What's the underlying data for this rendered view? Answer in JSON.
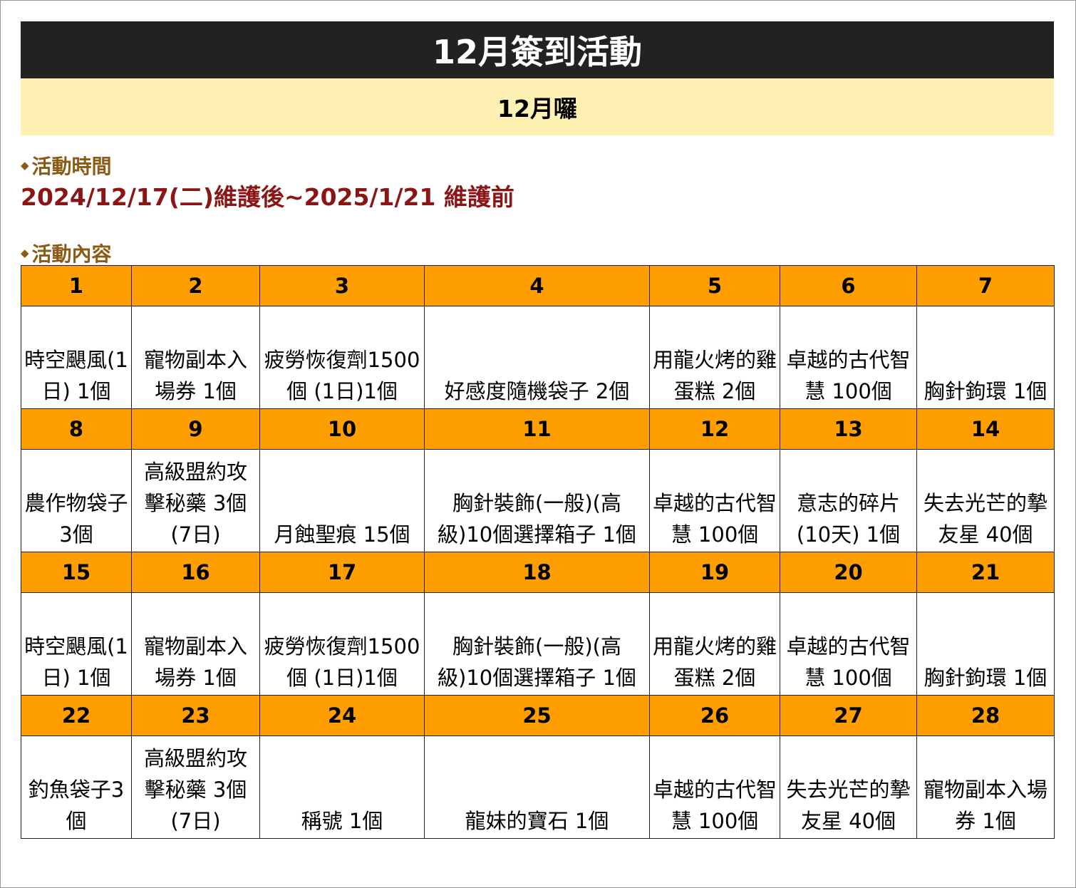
{
  "title": "12月簽到活動",
  "subtitle": "12月囉",
  "colors": {
    "title_bg": "#222222",
    "subtitle_bg": "#fff0b3",
    "header_row": "#ff9e00",
    "section_heading": "#8b5a14",
    "period_text": "#8b1414"
  },
  "sections": {
    "time_heading": "活動時間",
    "period": "2024/12/17(二)維護後~2025/1/21 維護前",
    "content_heading": "活動內容",
    "bullet_icon": "diamond-bullet"
  },
  "weeks": [
    {
      "days": [
        "1",
        "2",
        "3",
        "4",
        "5",
        "6",
        "7"
      ],
      "items": [
        "時空颶風(1日) 1個",
        "寵物副本入場券 1個",
        "疲勞恢復劑1500個 (1日)1個",
        "好感度隨機袋子 2個",
        "用龍火烤的雞蛋糕 2個",
        "卓越的古代智慧 100個",
        "胸針鉤環 1個"
      ]
    },
    {
      "days": [
        "8",
        "9",
        "10",
        "11",
        "12",
        "13",
        "14"
      ],
      "items": [
        "農作物袋子 3個",
        "高級盟約攻擊秘藥 3個(7日)",
        "月蝕聖痕 15個",
        "胸針裝飾(一般)(高級)10個選擇箱子 1個",
        "卓越的古代智慧 100個",
        "意志的碎片(10天) 1個",
        "失去光芒的摯友星 40個"
      ]
    },
    {
      "days": [
        "15",
        "16",
        "17",
        "18",
        "19",
        "20",
        "21"
      ],
      "items": [
        "時空颶風(1日) 1個",
        "寵物副本入場券 1個",
        "疲勞恢復劑1500個 (1日)1個",
        "胸針裝飾(一般)(高級)10個選擇箱子 1個",
        "用龍火烤的雞蛋糕 2個",
        "卓越的古代智慧 100個",
        "胸針鉤環 1個"
      ]
    },
    {
      "days": [
        "22",
        "23",
        "24",
        "25",
        "26",
        "27",
        "28"
      ],
      "items": [
        "釣魚袋子3個",
        "高級盟約攻擊秘藥 3個(7日)",
        "稱號 1個",
        "龍妹的寶石 1個",
        "卓越的古代智慧 100個",
        "失去光芒的摯友星 40個",
        "寵物副本入場券 1個"
      ]
    }
  ]
}
